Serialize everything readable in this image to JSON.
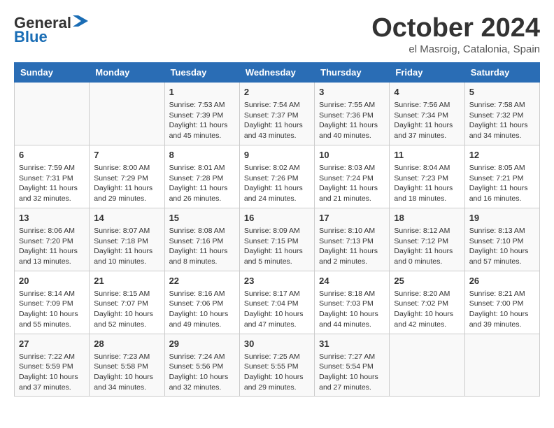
{
  "header": {
    "logo_general": "General",
    "logo_blue": "Blue",
    "month": "October 2024",
    "location": "el Masroig, Catalonia, Spain"
  },
  "weekdays": [
    "Sunday",
    "Monday",
    "Tuesday",
    "Wednesday",
    "Thursday",
    "Friday",
    "Saturday"
  ],
  "rows": [
    [
      {
        "day": "",
        "info": ""
      },
      {
        "day": "",
        "info": ""
      },
      {
        "day": "1",
        "info": "Sunrise: 7:53 AM\nSunset: 7:39 PM\nDaylight: 11 hours and 45 minutes."
      },
      {
        "day": "2",
        "info": "Sunrise: 7:54 AM\nSunset: 7:37 PM\nDaylight: 11 hours and 43 minutes."
      },
      {
        "day": "3",
        "info": "Sunrise: 7:55 AM\nSunset: 7:36 PM\nDaylight: 11 hours and 40 minutes."
      },
      {
        "day": "4",
        "info": "Sunrise: 7:56 AM\nSunset: 7:34 PM\nDaylight: 11 hours and 37 minutes."
      },
      {
        "day": "5",
        "info": "Sunrise: 7:58 AM\nSunset: 7:32 PM\nDaylight: 11 hours and 34 minutes."
      }
    ],
    [
      {
        "day": "6",
        "info": "Sunrise: 7:59 AM\nSunset: 7:31 PM\nDaylight: 11 hours and 32 minutes."
      },
      {
        "day": "7",
        "info": "Sunrise: 8:00 AM\nSunset: 7:29 PM\nDaylight: 11 hours and 29 minutes."
      },
      {
        "day": "8",
        "info": "Sunrise: 8:01 AM\nSunset: 7:28 PM\nDaylight: 11 hours and 26 minutes."
      },
      {
        "day": "9",
        "info": "Sunrise: 8:02 AM\nSunset: 7:26 PM\nDaylight: 11 hours and 24 minutes."
      },
      {
        "day": "10",
        "info": "Sunrise: 8:03 AM\nSunset: 7:24 PM\nDaylight: 11 hours and 21 minutes."
      },
      {
        "day": "11",
        "info": "Sunrise: 8:04 AM\nSunset: 7:23 PM\nDaylight: 11 hours and 18 minutes."
      },
      {
        "day": "12",
        "info": "Sunrise: 8:05 AM\nSunset: 7:21 PM\nDaylight: 11 hours and 16 minutes."
      }
    ],
    [
      {
        "day": "13",
        "info": "Sunrise: 8:06 AM\nSunset: 7:20 PM\nDaylight: 11 hours and 13 minutes."
      },
      {
        "day": "14",
        "info": "Sunrise: 8:07 AM\nSunset: 7:18 PM\nDaylight: 11 hours and 10 minutes."
      },
      {
        "day": "15",
        "info": "Sunrise: 8:08 AM\nSunset: 7:16 PM\nDaylight: 11 hours and 8 minutes."
      },
      {
        "day": "16",
        "info": "Sunrise: 8:09 AM\nSunset: 7:15 PM\nDaylight: 11 hours and 5 minutes."
      },
      {
        "day": "17",
        "info": "Sunrise: 8:10 AM\nSunset: 7:13 PM\nDaylight: 11 hours and 2 minutes."
      },
      {
        "day": "18",
        "info": "Sunrise: 8:12 AM\nSunset: 7:12 PM\nDaylight: 11 hours and 0 minutes."
      },
      {
        "day": "19",
        "info": "Sunrise: 8:13 AM\nSunset: 7:10 PM\nDaylight: 10 hours and 57 minutes."
      }
    ],
    [
      {
        "day": "20",
        "info": "Sunrise: 8:14 AM\nSunset: 7:09 PM\nDaylight: 10 hours and 55 minutes."
      },
      {
        "day": "21",
        "info": "Sunrise: 8:15 AM\nSunset: 7:07 PM\nDaylight: 10 hours and 52 minutes."
      },
      {
        "day": "22",
        "info": "Sunrise: 8:16 AM\nSunset: 7:06 PM\nDaylight: 10 hours and 49 minutes."
      },
      {
        "day": "23",
        "info": "Sunrise: 8:17 AM\nSunset: 7:04 PM\nDaylight: 10 hours and 47 minutes."
      },
      {
        "day": "24",
        "info": "Sunrise: 8:18 AM\nSunset: 7:03 PM\nDaylight: 10 hours and 44 minutes."
      },
      {
        "day": "25",
        "info": "Sunrise: 8:20 AM\nSunset: 7:02 PM\nDaylight: 10 hours and 42 minutes."
      },
      {
        "day": "26",
        "info": "Sunrise: 8:21 AM\nSunset: 7:00 PM\nDaylight: 10 hours and 39 minutes."
      }
    ],
    [
      {
        "day": "27",
        "info": "Sunrise: 7:22 AM\nSunset: 5:59 PM\nDaylight: 10 hours and 37 minutes."
      },
      {
        "day": "28",
        "info": "Sunrise: 7:23 AM\nSunset: 5:58 PM\nDaylight: 10 hours and 34 minutes."
      },
      {
        "day": "29",
        "info": "Sunrise: 7:24 AM\nSunset: 5:56 PM\nDaylight: 10 hours and 32 minutes."
      },
      {
        "day": "30",
        "info": "Sunrise: 7:25 AM\nSunset: 5:55 PM\nDaylight: 10 hours and 29 minutes."
      },
      {
        "day": "31",
        "info": "Sunrise: 7:27 AM\nSunset: 5:54 PM\nDaylight: 10 hours and 27 minutes."
      },
      {
        "day": "",
        "info": ""
      },
      {
        "day": "",
        "info": ""
      }
    ]
  ]
}
